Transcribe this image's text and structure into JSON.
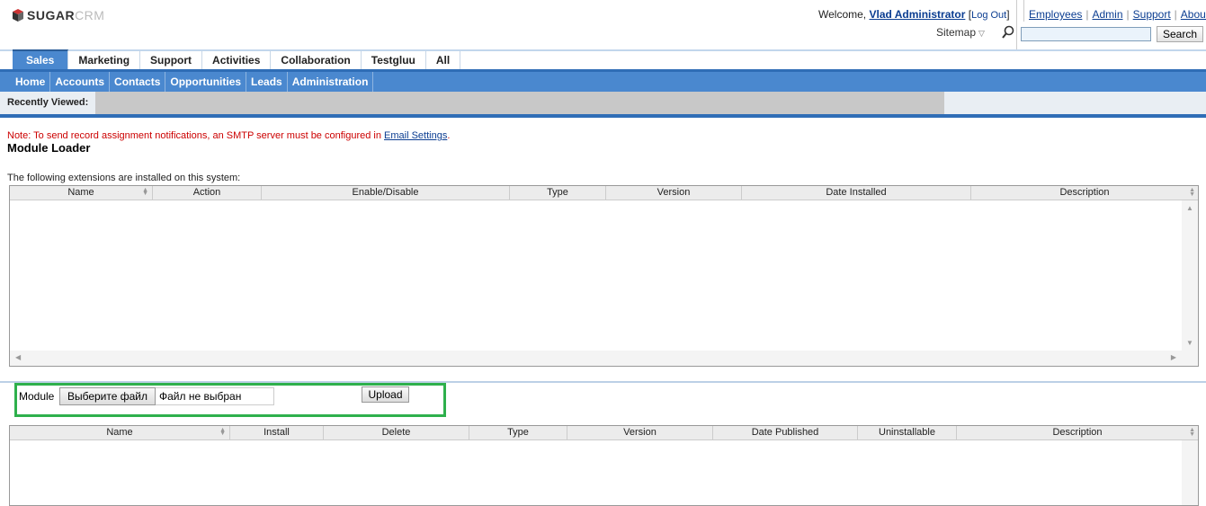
{
  "header": {
    "brand": "SUGAR",
    "brand_suffix": "CRM",
    "welcome_prefix": "Welcome,",
    "user_name": "Vlad Administrator",
    "logout_open": "[",
    "logout_label": "Log Out",
    "logout_close": "]",
    "links": [
      "Employees",
      "Admin",
      "Support",
      "About"
    ],
    "sitemap_label": "Sitemap",
    "search_value": "",
    "search_button": "Search"
  },
  "tabs": [
    {
      "label": "Sales",
      "active": true
    },
    {
      "label": "Marketing"
    },
    {
      "label": "Support"
    },
    {
      "label": "Activities"
    },
    {
      "label": "Collaboration"
    },
    {
      "label": "Testgluu"
    },
    {
      "label": "All"
    }
  ],
  "subnav": [
    "Home",
    "Accounts",
    "Contacts",
    "Opportunities",
    "Leads",
    "Administration"
  ],
  "recent": {
    "label": "Recently Viewed:"
  },
  "note": {
    "text": "Note: To send record assignment notifications, an SMTP server must be configured in ",
    "link": "Email Settings",
    "suffix": "."
  },
  "page_title": "Module Loader",
  "installed": {
    "caption": "The following extensions are installed on this system:",
    "columns": [
      "Name",
      "Action",
      "Enable/Disable",
      "Type",
      "Version",
      "Date Installed",
      "Description"
    ],
    "rows": []
  },
  "upload": {
    "label": "Module",
    "choose_button": "Выберите файл",
    "file_status": "Файл не выбран",
    "upload_button": "Upload"
  },
  "packages": {
    "columns": [
      "Name",
      "Install",
      "Delete",
      "Type",
      "Version",
      "Date Published",
      "Uninstallable",
      "Description"
    ],
    "rows": []
  },
  "colors": {
    "tab_active": "#4a88cf",
    "subnav_bg": "#4a88cf",
    "nav_line": "#2f6db6",
    "note_red": "#cc0000",
    "highlight_green": "#2eb04c"
  }
}
